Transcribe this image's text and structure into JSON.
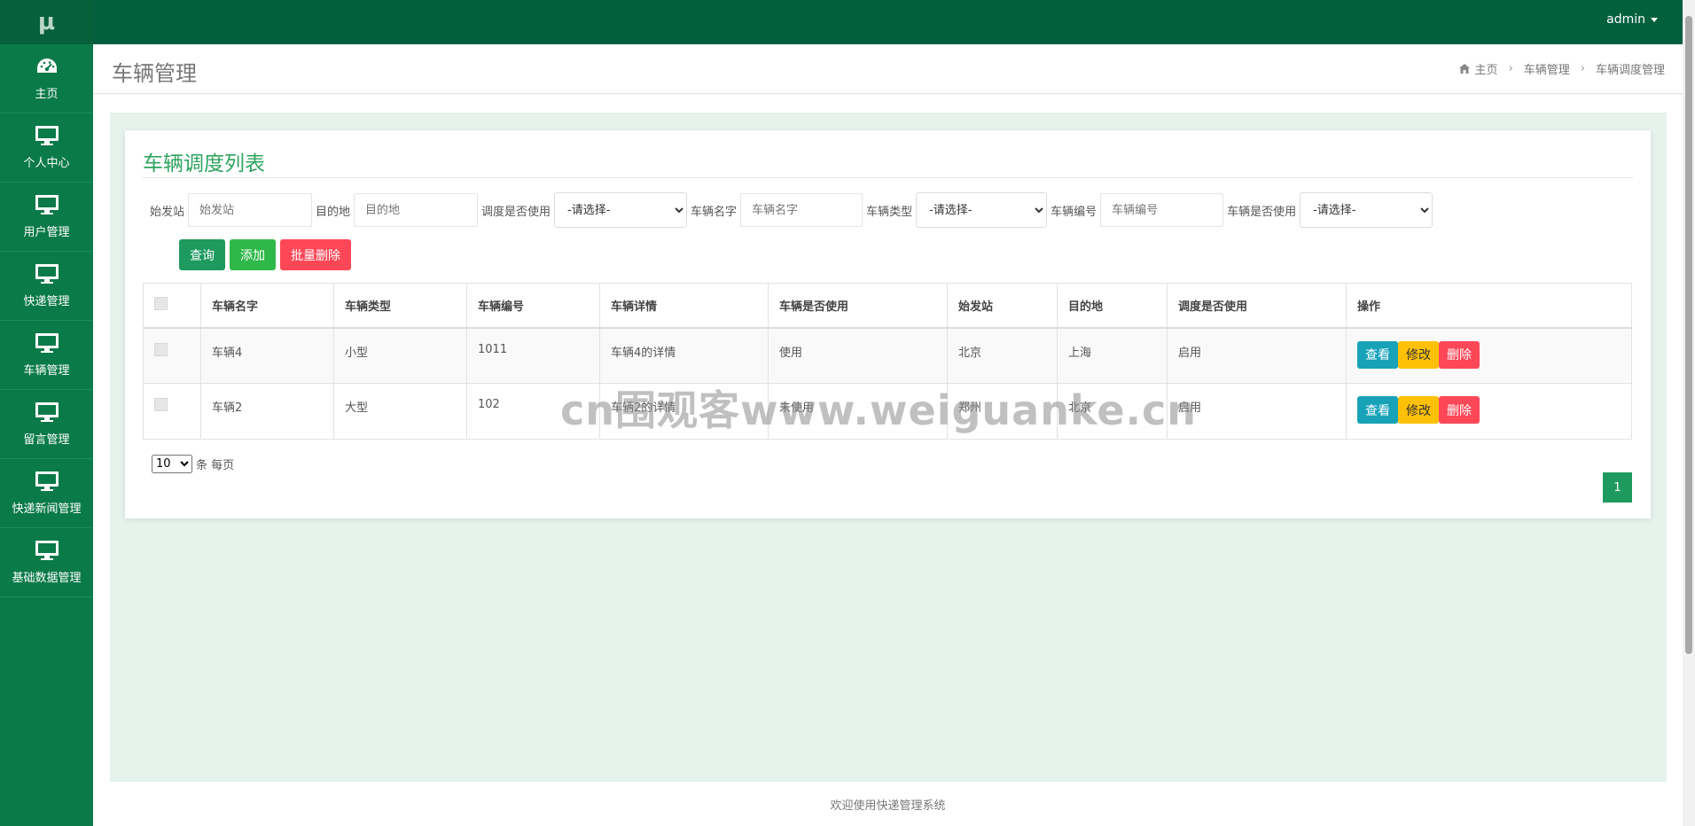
{
  "app": {
    "logo": "μ",
    "user": "admin"
  },
  "sidebar": {
    "items": [
      {
        "label": "主页",
        "icon": "dashboard-icon"
      },
      {
        "label": "个人中心",
        "icon": "monitor-icon"
      },
      {
        "label": "用户管理",
        "icon": "monitor-icon"
      },
      {
        "label": "快递管理",
        "icon": "monitor-icon"
      },
      {
        "label": "车辆管理",
        "icon": "monitor-icon"
      },
      {
        "label": "留言管理",
        "icon": "monitor-icon"
      },
      {
        "label": "快递新闻管理",
        "icon": "monitor-icon"
      },
      {
        "label": "基础数据管理",
        "icon": "monitor-icon"
      }
    ]
  },
  "header": {
    "title": "车辆管理",
    "breadcrumb": {
      "home": "主页",
      "section": "车辆管理",
      "current": "车辆调度管理"
    }
  },
  "card": {
    "title": "车辆调度列表",
    "filters": {
      "start_label": "始发站",
      "start_placeholder": "始发站",
      "dest_label": "目的地",
      "dest_placeholder": "目的地",
      "dispatch_label": "调度是否使用",
      "dispatch_value": "-请选择-",
      "name_label": "车辆名字",
      "name_placeholder": "车辆名字",
      "type_label": "车辆类型",
      "type_value": "-请选择-",
      "no_label": "车辆编号",
      "no_placeholder": "车辆编号",
      "inuse_label": "车辆是否使用",
      "inuse_value": "-请选择-"
    },
    "buttons": {
      "query": "查询",
      "add": "添加",
      "batch_delete": "批量删除"
    },
    "table": {
      "headers": {
        "name": "车辆名字",
        "type": "车辆类型",
        "no": "车辆编号",
        "detail": "车辆详情",
        "inuse": "车辆是否使用",
        "start": "始发站",
        "dest": "目的地",
        "dispatch": "调度是否使用",
        "action": "操作"
      },
      "rows": [
        {
          "name": "车辆4",
          "type": "小型",
          "no": "1011",
          "detail": "车辆4的详情",
          "inuse": "使用",
          "start": "北京",
          "dest": "上海",
          "dispatch": "启用"
        },
        {
          "name": "车辆2",
          "type": "大型",
          "no": "102",
          "detail": "车辆2的详情",
          "inuse": "未使用",
          "start": "郑州",
          "dest": "北京",
          "dispatch": "启用"
        }
      ],
      "actions": {
        "view": "查看",
        "edit": "修改",
        "delete": "删除"
      }
    },
    "pagination": {
      "page_size": "10",
      "page_size_suffix": "条 每页",
      "current_page": "1"
    }
  },
  "watermark": "cn围观客www.weiguanke.cn",
  "footer": "欢迎使用快递管理系统",
  "colors": {
    "sidebar": "#0a7a48",
    "topbar": "#03603f",
    "accent": "#2fa45f",
    "danger": "#ff4757",
    "info": "#17a2b8",
    "warning": "#ffc107"
  }
}
